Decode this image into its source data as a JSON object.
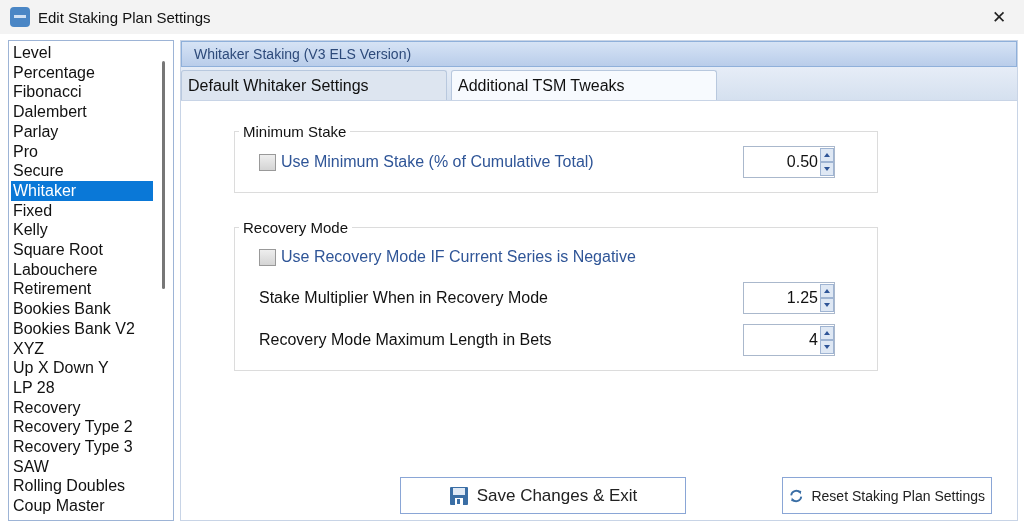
{
  "window": {
    "title": "Edit Staking Plan Settings",
    "close": "✕"
  },
  "plans": [
    {
      "label": "Level",
      "selected": false
    },
    {
      "label": "Percentage",
      "selected": false
    },
    {
      "label": "Fibonacci",
      "selected": false
    },
    {
      "label": "Dalembert",
      "selected": false
    },
    {
      "label": "Parlay",
      "selected": false
    },
    {
      "label": "Pro",
      "selected": false
    },
    {
      "label": "Secure",
      "selected": false
    },
    {
      "label": "Whitaker",
      "selected": true
    },
    {
      "label": "Fixed",
      "selected": false
    },
    {
      "label": "Kelly",
      "selected": false
    },
    {
      "label": "Square Root",
      "selected": false
    },
    {
      "label": "Labouchere",
      "selected": false
    },
    {
      "label": "Retirement",
      "selected": false
    },
    {
      "label": "Bookies Bank",
      "selected": false
    },
    {
      "label": "Bookies Bank V2",
      "selected": false
    },
    {
      "label": "XYZ",
      "selected": false
    },
    {
      "label": "Up X Down Y",
      "selected": false
    },
    {
      "label": "LP 28",
      "selected": false
    },
    {
      "label": "Recovery",
      "selected": false
    },
    {
      "label": "Recovery Type 2",
      "selected": false
    },
    {
      "label": "Recovery Type 3",
      "selected": false
    },
    {
      "label": "SAW",
      "selected": false
    },
    {
      "label": "Rolling Doubles",
      "selected": false
    },
    {
      "label": "Coup Master",
      "selected": false
    }
  ],
  "panel_title": "Whitaker Staking (V3 ELS Version)",
  "tabs": [
    {
      "label": "Default Whitaker Settings",
      "selected": false
    },
    {
      "label": "Additional TSM Tweaks",
      "selected": true
    }
  ],
  "groups": [
    {
      "title": "Minimum Stake",
      "rows": [
        {
          "kind": "checkspin",
          "label": "Use Minimum Stake (% of Cumulative Total)",
          "checked": false,
          "value": "0.50"
        }
      ]
    },
    {
      "title": "Recovery Mode",
      "rows": [
        {
          "kind": "check",
          "label": "Use Recovery Mode IF Current Series is Negative",
          "checked": false
        },
        {
          "kind": "spin",
          "label": "Stake Multiplier When in Recovery Mode",
          "value": "1.25"
        },
        {
          "kind": "spin",
          "label": "Recovery Mode Maximum Length in Bets",
          "value": "4"
        }
      ]
    }
  ],
  "buttons": [
    {
      "kind": "save",
      "label": "Save Changes & Exit"
    },
    {
      "kind": "reset",
      "label": "Reset Staking Plan Settings"
    }
  ]
}
